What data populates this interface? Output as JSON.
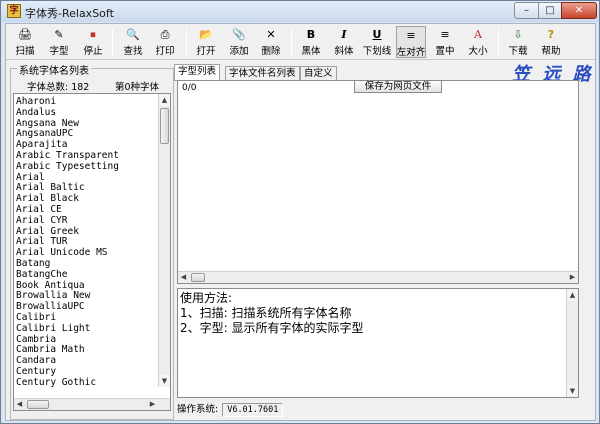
{
  "window": {
    "title": "字体秀-RelaxSoft",
    "app_icon_glyph": "字",
    "controls": {
      "minimize": "–",
      "maximize": "□",
      "close": "✕"
    }
  },
  "toolbar": [
    {
      "id": "scan",
      "label": "扫描",
      "icon": "scan-icon",
      "glyph": "🖨"
    },
    {
      "id": "glyph",
      "label": "字型",
      "icon": "font-preview-icon",
      "glyph": "✎"
    },
    {
      "id": "stop",
      "label": "停止",
      "icon": "stop-icon",
      "glyph": "⏹"
    },
    {
      "id": "find",
      "label": "查找",
      "icon": "find-icon",
      "glyph": "🔍"
    },
    {
      "id": "print",
      "label": "打印",
      "icon": "print-icon",
      "glyph": "⎙"
    },
    {
      "id": "open",
      "label": "打开",
      "icon": "open-folder-icon",
      "glyph": "📂"
    },
    {
      "id": "add",
      "label": "添加",
      "icon": "paperclip-icon",
      "glyph": "📎"
    },
    {
      "id": "delete",
      "label": "删除",
      "icon": "delete-icon",
      "glyph": "✕"
    },
    {
      "id": "bold",
      "label": "黑体",
      "icon": "bold-icon",
      "glyph": "B"
    },
    {
      "id": "italic",
      "label": "斜体",
      "icon": "italic-icon",
      "glyph": "I"
    },
    {
      "id": "underline",
      "label": "下划线",
      "icon": "underline-icon",
      "glyph": "U"
    },
    {
      "id": "align_left",
      "label": "左对齐",
      "icon": "align-left-icon",
      "glyph": "≡"
    },
    {
      "id": "center",
      "label": "置中",
      "icon": "align-center-icon",
      "glyph": "≡"
    },
    {
      "id": "size",
      "label": "大小",
      "icon": "font-size-icon",
      "glyph": "A"
    },
    {
      "id": "download",
      "label": "下载",
      "icon": "download-icon",
      "glyph": "⇩"
    },
    {
      "id": "help",
      "label": "帮助",
      "icon": "help-icon",
      "glyph": "?"
    }
  ],
  "font_panel": {
    "title": "系统字体名列表",
    "count_text": "字体总数: 182",
    "index_text": "第0种字体",
    "fonts": [
      "Aharoni",
      "Andalus",
      "Angsana New",
      "AngsanaUPC",
      "Aparajita",
      "Arabic Transparent",
      "Arabic Typesetting",
      "Arial",
      "Arial Baltic",
      "Arial Black",
      "Arial CE",
      "Arial CYR",
      "Arial Greek",
      "Arial TUR",
      "Arial Unicode MS",
      "Batang",
      "BatangChe",
      "Book Antiqua",
      "Browallia New",
      "BrowalliaUPC",
      "Calibri",
      "Calibri Light",
      "Cambria",
      "Cambria Math",
      "Candara",
      "Century",
      "Century Gothic"
    ]
  },
  "tabs": [
    {
      "label": "字型列表",
      "active": true
    },
    {
      "label": "字体文件名列表",
      "active": false
    },
    {
      "label": "自定义",
      "active": false
    }
  ],
  "logo_text": "笠 远 路",
  "preview": {
    "page_label": "0/0",
    "save_button": "保存为网页文件"
  },
  "help": {
    "lines": [
      "使用方法:",
      "1、扫描: 扫描系统所有字体名称",
      "2、字型: 显示所有字体的实际字型"
    ]
  },
  "status": {
    "label": "操作系统:",
    "value": "V6.01.7601"
  },
  "colors": {
    "stop_red": "#c0302a",
    "logo_blue": "#2a4dbf",
    "title_bar": "#dbe5f0"
  }
}
